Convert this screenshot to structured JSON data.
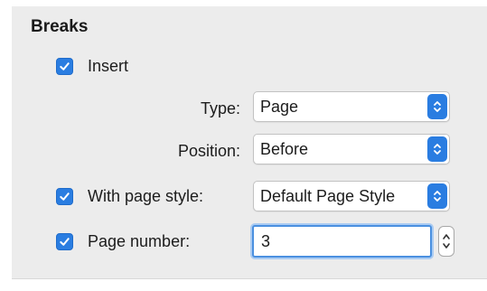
{
  "breaks": {
    "heading": "Breaks",
    "insert": {
      "label": "Insert",
      "checked": true
    },
    "type": {
      "label": "Type:",
      "value": "Page"
    },
    "position": {
      "label": "Position:",
      "value": "Before"
    },
    "with_page_style": {
      "label": "With page style:",
      "checked": true,
      "value": "Default Page Style"
    },
    "page_number": {
      "label": "Page number:",
      "checked": true,
      "value": "3"
    }
  },
  "colors": {
    "accent": "#2a7de1",
    "panel_bg": "#ececec",
    "focus_ring": "#4a90e0"
  },
  "icons": {
    "checkbox": "checkmark-icon",
    "select": "updown-chevron-icon",
    "spinner": "spin-arrows-icon"
  }
}
